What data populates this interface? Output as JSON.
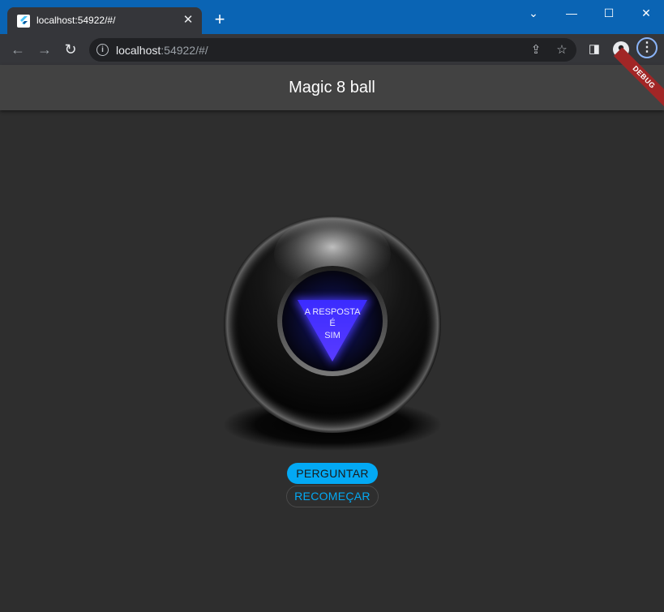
{
  "browser": {
    "tab_title": "localhost:54922/#/",
    "tab_close": "✕",
    "new_tab": "+",
    "url_host": "localhost",
    "url_rest": ":54922/#/",
    "window_controls": {
      "dropdown": "⌄",
      "minimize": "—",
      "maximize": "☐",
      "close": "✕"
    }
  },
  "app": {
    "title": "Magic 8 ball",
    "debug_banner": "DEBUG",
    "answer": {
      "line1": "A RESPOSTA",
      "line2": "É",
      "line3": "SIM"
    },
    "buttons": {
      "ask": "PERGUNTAR",
      "reset": "RECOMEÇAR"
    }
  },
  "colors": {
    "chrome_accent": "#0a64b4",
    "app_background": "#2e2e2e",
    "appbar": "#424242",
    "primary": "#03a9f4",
    "answer_triangle": "#3b2bff",
    "debug_banner": "#a12626"
  }
}
